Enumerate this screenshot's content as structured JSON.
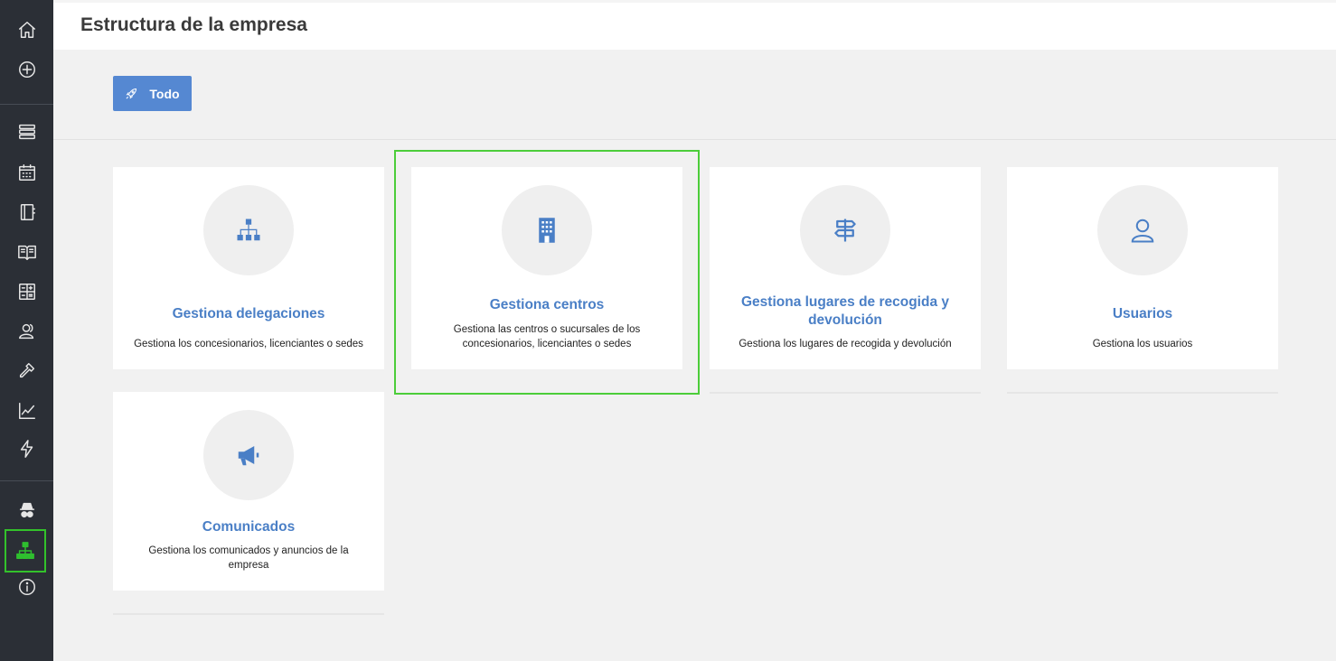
{
  "header": {
    "title": "Estructura de la empresa"
  },
  "toolbar": {
    "todo_label": "Todo"
  },
  "cards": [
    {
      "title": "Gestiona delegaciones",
      "desc": "Gestiona los concesionarios, licenciantes o sedes",
      "icon": "sitemap-icon"
    },
    {
      "title": "Gestiona centros",
      "desc": "Gestiona las centros o sucursales de los concesionarios, licenciantes o sedes",
      "icon": "building-icon"
    },
    {
      "title": "Gestiona lugares de recogida y devolución",
      "desc": "Gestiona los lugares de recogida y devolución",
      "icon": "signpost-icon"
    },
    {
      "title": "Usuarios",
      "desc": "Gestiona los usuarios",
      "icon": "user-icon"
    },
    {
      "title": "Comunicados",
      "desc": "Gestiona los comunicados y anuncios de la empresa",
      "icon": "megaphone-icon"
    }
  ],
  "colors": {
    "accent": "#5588d2",
    "sidebar": "#2b2f36",
    "highlight": "#4ccd3a"
  }
}
